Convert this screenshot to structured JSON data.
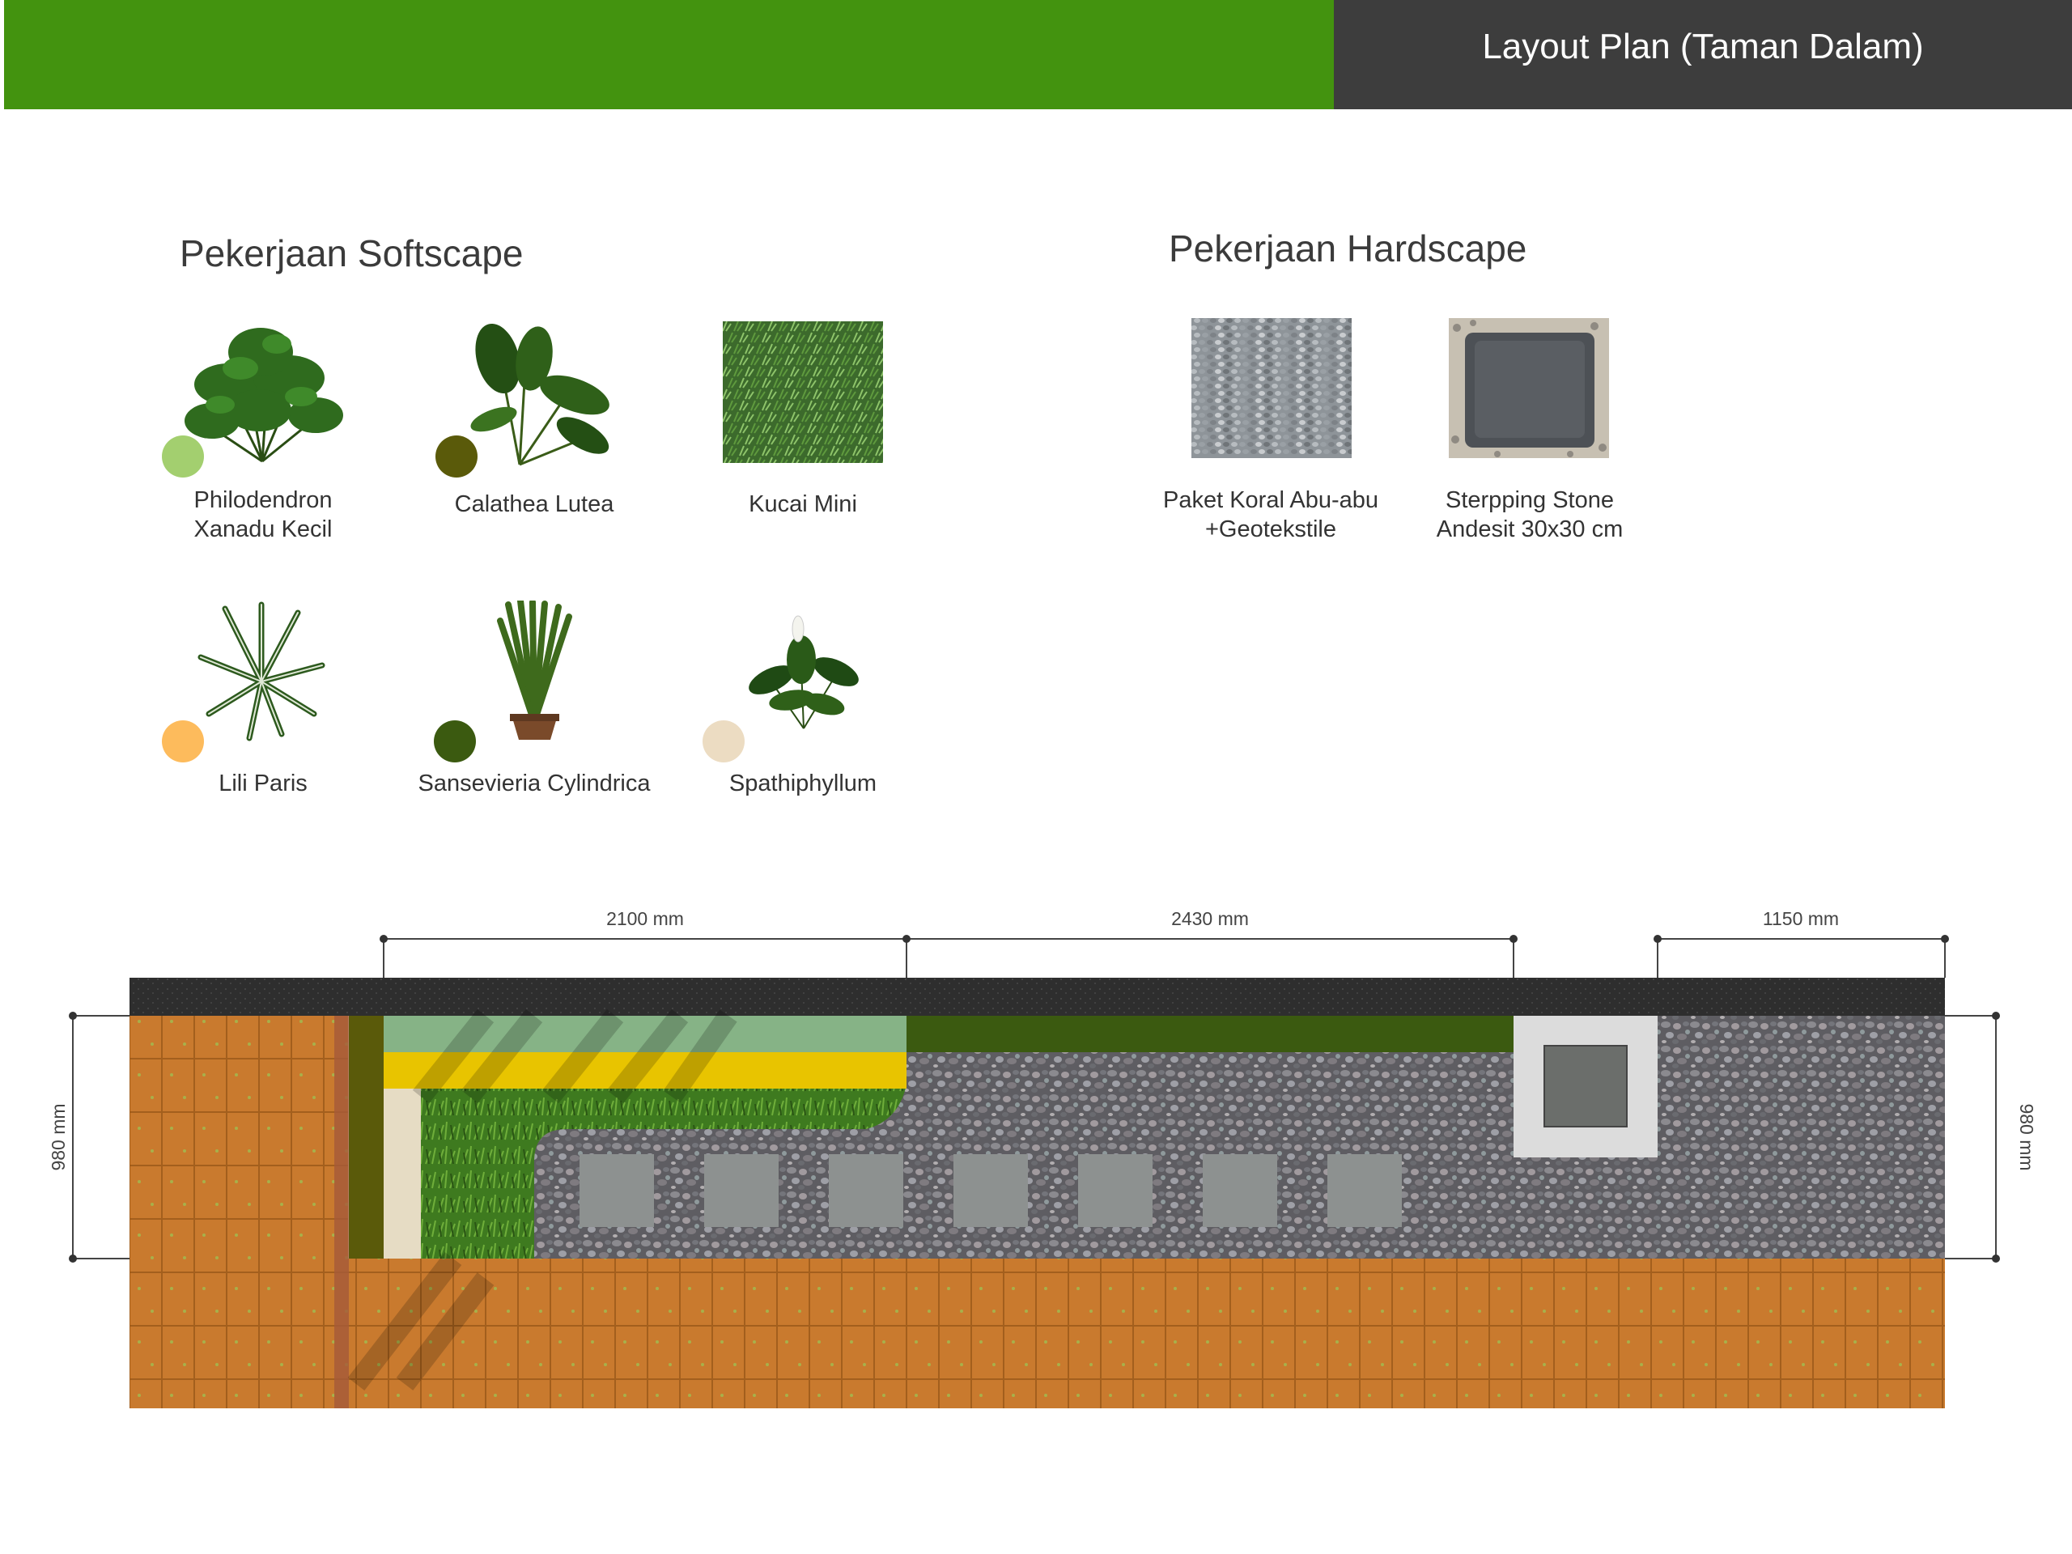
{
  "header": {
    "title": "Layout Plan (Taman Dalam)"
  },
  "softscape": {
    "title": "Pekerjaan Softscape",
    "items": [
      {
        "label_line1": "Philodendron",
        "label_line2": "Xanadu Kecil",
        "icon": "philodendron-plant-icon",
        "legend_color": "#a3cf6f"
      },
      {
        "label_line1": "Calathea Lutea",
        "label_line2": "",
        "icon": "calathea-plant-icon",
        "legend_color": "#5a5a0a"
      },
      {
        "label_line1": "Kucai Mini",
        "label_line2": "",
        "icon": "grass-texture-icon",
        "legend_color": ""
      },
      {
        "label_line1": "Lili Paris",
        "label_line2": "",
        "icon": "spider-plant-icon",
        "legend_color": "#fdbb5c"
      },
      {
        "label_line1": "Sansevieria Cylindrica",
        "label_line2": "",
        "icon": "sansevieria-plant-icon",
        "legend_color": "#3b5a10"
      },
      {
        "label_line1": "Spathiphyllum",
        "label_line2": "",
        "icon": "peace-lily-plant-icon",
        "legend_color": "#ecdcc2"
      }
    ]
  },
  "hardscape": {
    "title": "Pekerjaan Hardscape",
    "items": [
      {
        "label_line1": "Paket Koral Abu-abu",
        "label_line2": "+Geotekstile",
        "icon": "gravel-texture-icon"
      },
      {
        "label_line1": "Sterpping Stone",
        "label_line2": "Andesit 30x30 cm",
        "icon": "stepping-stone-icon"
      }
    ]
  },
  "plan": {
    "dim_top": [
      "2100 mm",
      "2430 mm",
      "1150 mm"
    ],
    "dim_left": "980 mm",
    "dim_right": "980 mm",
    "colors": {
      "wall": "#2f2f2f",
      "tile": "#c87a2c",
      "calathea_strip": "#5a5a0a",
      "philodendron_strip": "#86b386",
      "lili_strip": "#e8c400",
      "sansevieria_strip": "#3b5a10",
      "spathiphyllum_strip": "#e6dcc4",
      "grass": "#3d7a1e",
      "gravel": "#6e6e72",
      "stepping_stone": "#8d9190",
      "drain_frame": "#dadada",
      "drain_grate": "#6c6f6c"
    },
    "stepping_stone_count": 7
  }
}
